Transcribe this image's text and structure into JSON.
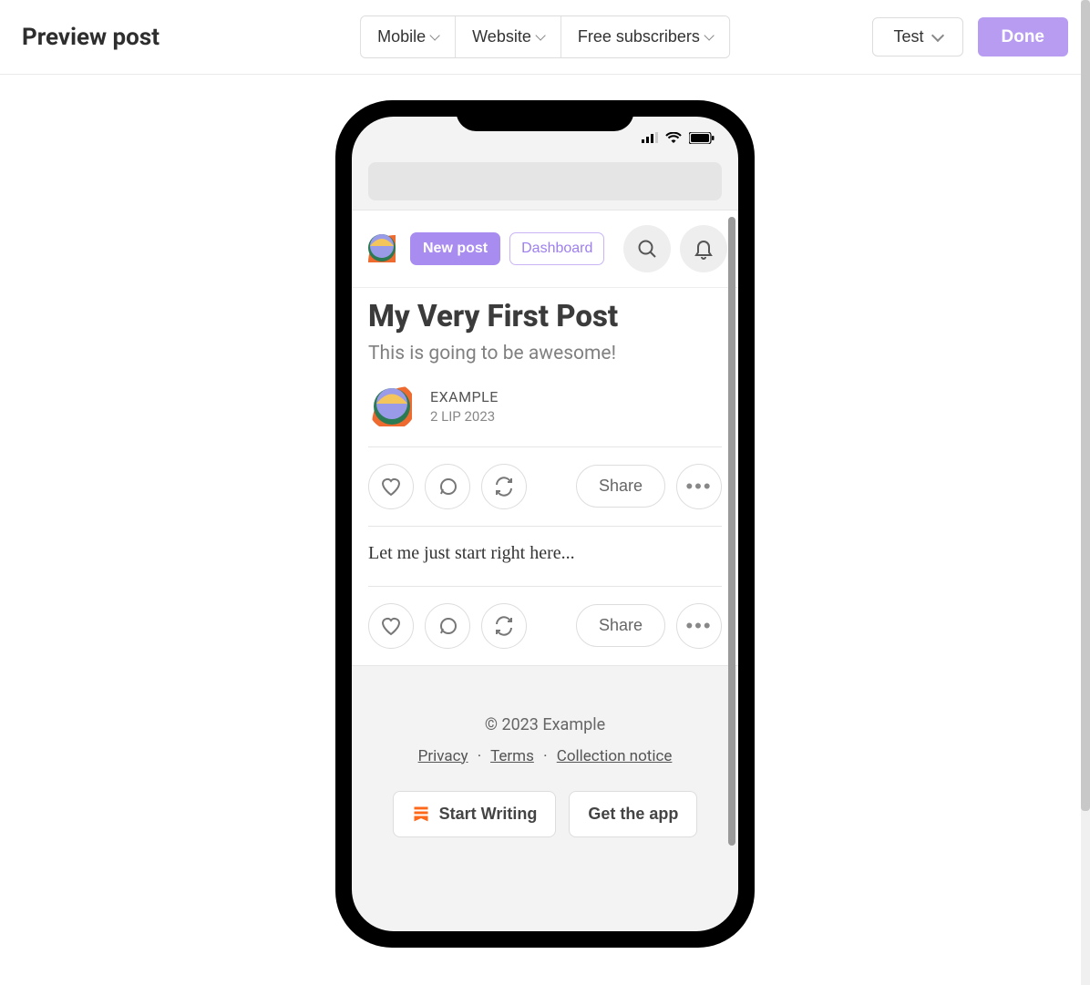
{
  "header": {
    "title": "Preview post",
    "tabs": {
      "mobile": "Mobile",
      "website": "Website",
      "audience": "Free subscribers"
    },
    "test_label": "Test",
    "done_label": "Done"
  },
  "post_toolbar": {
    "new_post": "New post",
    "dashboard": "Dashboard"
  },
  "post": {
    "title": "My Very First Post",
    "subtitle": "This is going to be awesome!",
    "author": "EXAMPLE",
    "date": "2 LIP 2023",
    "share_label": "Share",
    "body": "Let me just start right here..."
  },
  "footer": {
    "copyright": "© 2023 Example",
    "privacy": "Privacy",
    "terms": "Terms",
    "collection": "Collection notice",
    "start_writing": "Start Writing",
    "get_app": "Get the app"
  },
  "colors": {
    "accent": "#a98cf0",
    "substack_orange": "#ff6719"
  }
}
